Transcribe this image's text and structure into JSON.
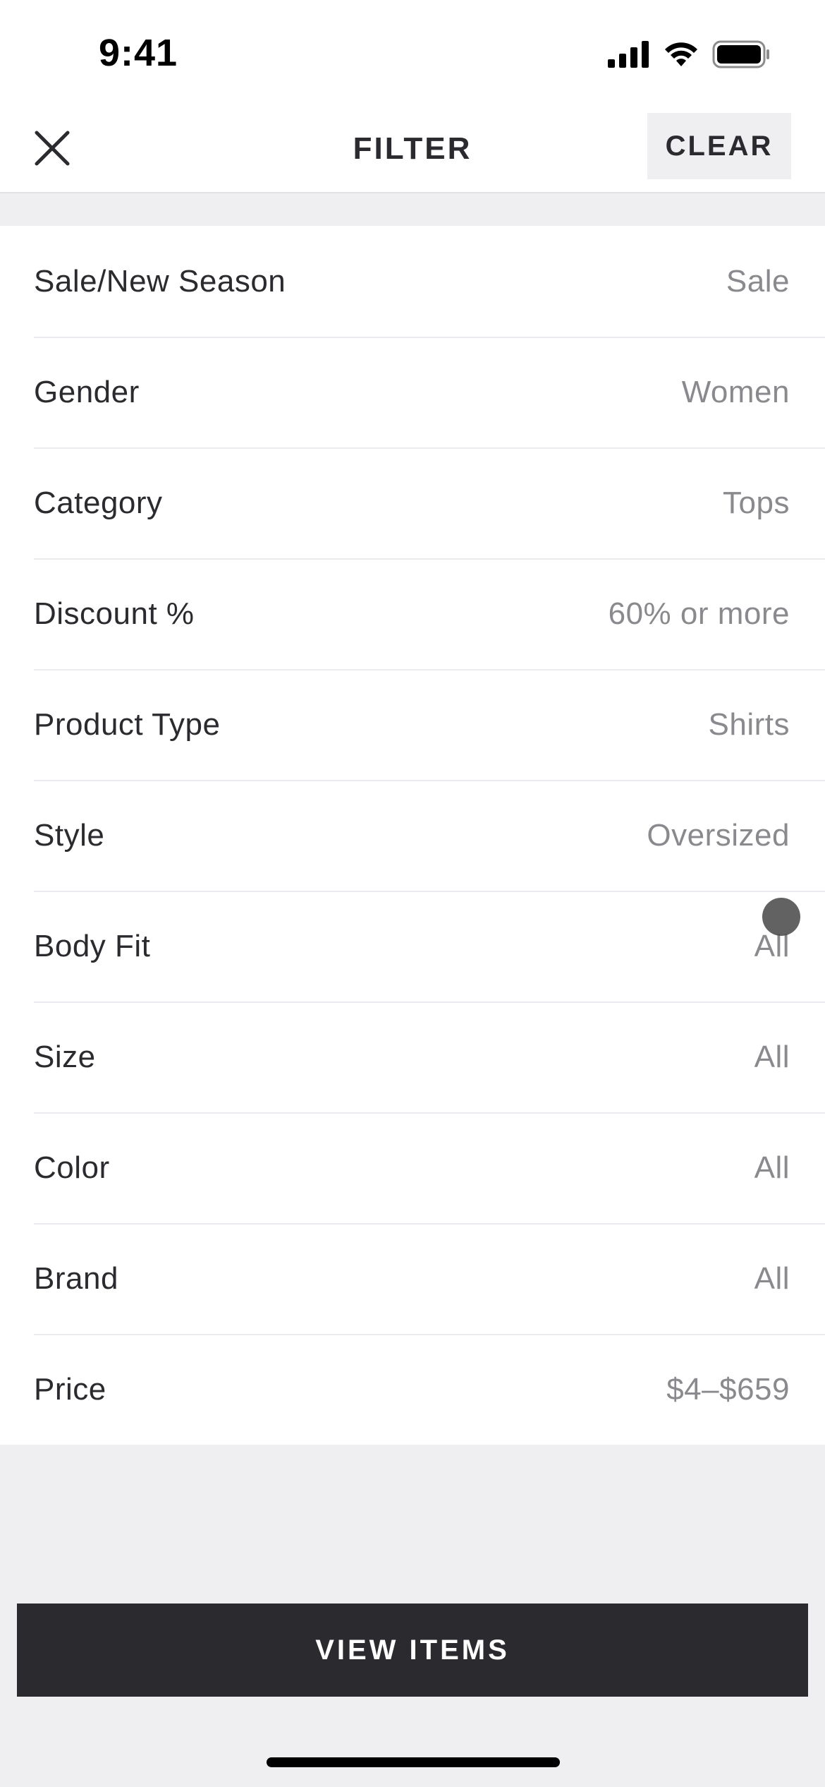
{
  "status_bar": {
    "time": "9:41",
    "icons": [
      "cellular-signal-icon",
      "wifi-icon",
      "battery-icon"
    ]
  },
  "header": {
    "title": "FILTER",
    "close_icon": "close-icon",
    "clear_label": "CLEAR"
  },
  "filters": [
    {
      "label": "Sale/New Season",
      "value": "Sale"
    },
    {
      "label": "Gender",
      "value": "Women"
    },
    {
      "label": "Category",
      "value": "Tops"
    },
    {
      "label": "Discount %",
      "value": "60% or more"
    },
    {
      "label": "Product Type",
      "value": "Shirts"
    },
    {
      "label": "Style",
      "value": "Oversized"
    },
    {
      "label": "Body Fit",
      "value": "All"
    },
    {
      "label": "Size",
      "value": "All"
    },
    {
      "label": "Color",
      "value": "All"
    },
    {
      "label": "Brand",
      "value": "All"
    },
    {
      "label": "Price",
      "value": "$4–$659"
    }
  ],
  "footer": {
    "view_items_label": "VIEW ITEMS"
  },
  "colors": {
    "background": "#efeef1",
    "primary_button": "#2b2a2e",
    "text": "#2b2a2e",
    "value_text": "#8a898d"
  }
}
